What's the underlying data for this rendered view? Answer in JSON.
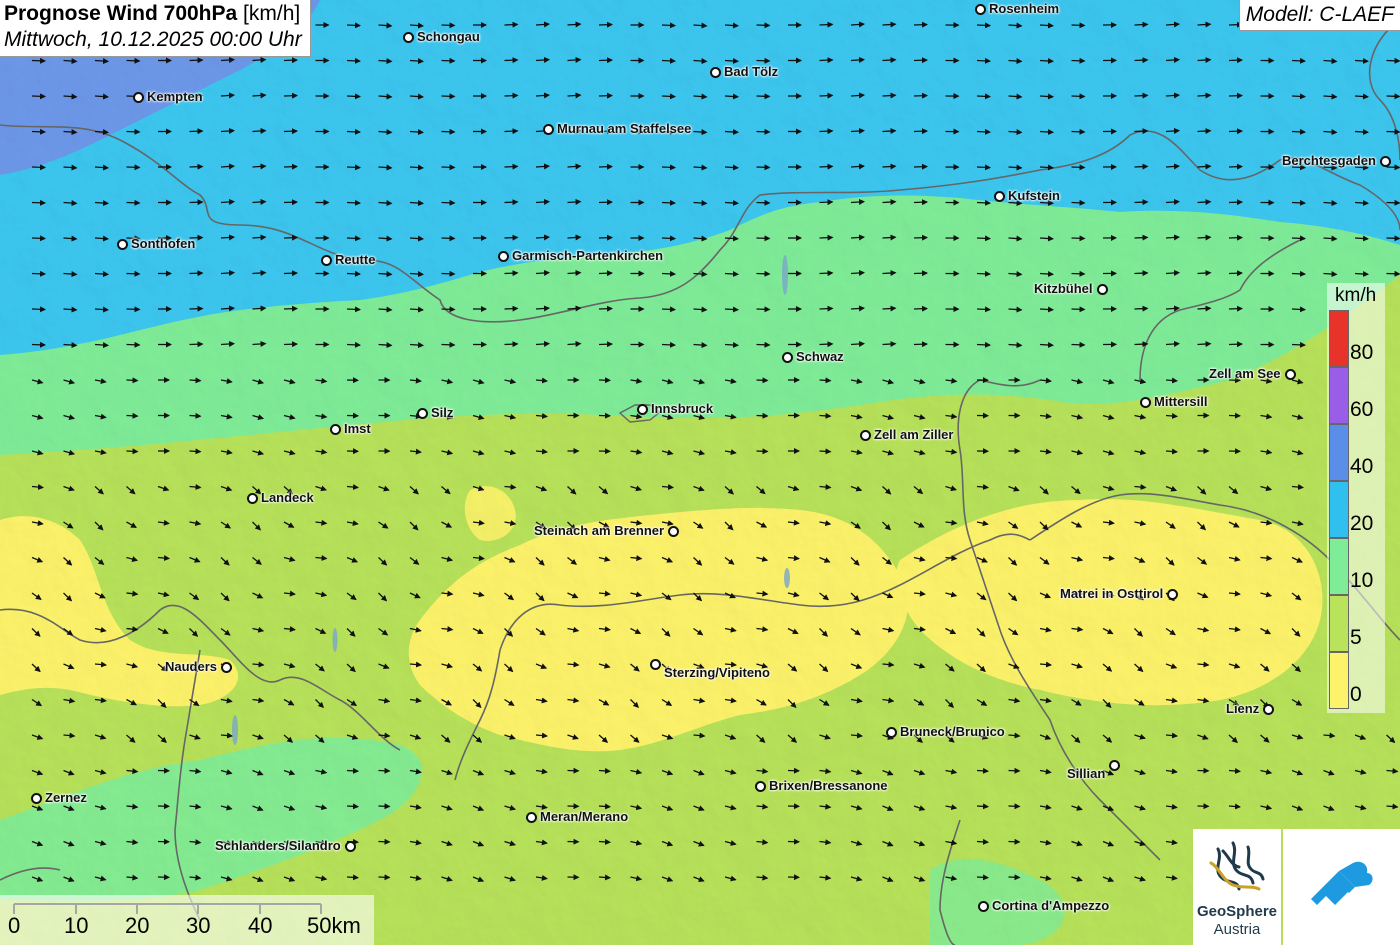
{
  "header": {
    "title_bold": "Prognose Wind 700hPa",
    "title_unit": "[km/h]",
    "datetime": "Mittwoch, 10.12.2025 00:00 Uhr",
    "model": "Modell: C-LAEF"
  },
  "legend": {
    "unit": "km/h",
    "items": [
      {
        "label": "80",
        "color": "#e8332b"
      },
      {
        "label": "60",
        "color": "#9a5de8"
      },
      {
        "label": "40",
        "color": "#5a8ee8"
      },
      {
        "label": "20",
        "color": "#2fc0ef"
      },
      {
        "label": "10",
        "color": "#7fed98"
      },
      {
        "label": "5",
        "color": "#b8e35a"
      },
      {
        "label": "0",
        "color": "#fdf36a"
      }
    ]
  },
  "scalebar": {
    "labels": [
      "0",
      "10",
      "20",
      "30",
      "40",
      "50km"
    ]
  },
  "cities": [
    {
      "name": "Rosenheim"
    },
    {
      "name": "Schongau"
    },
    {
      "name": "Bad Tölz"
    },
    {
      "name": "Kempten"
    },
    {
      "name": "Murnau am Staffelsee"
    },
    {
      "name": "Berchtesgaden"
    },
    {
      "name": "Kufstein"
    },
    {
      "name": "Sonthofen"
    },
    {
      "name": "Reutte"
    },
    {
      "name": "Garmisch-Partenkirchen"
    },
    {
      "name": "Kitzbühel"
    },
    {
      "name": "Schwaz"
    },
    {
      "name": "Zell am See"
    },
    {
      "name": "Mittersill"
    },
    {
      "name": "Silz"
    },
    {
      "name": "Innsbruck"
    },
    {
      "name": "Imst"
    },
    {
      "name": "Zell am Ziller"
    },
    {
      "name": "Landeck"
    },
    {
      "name": "Steinach am Brenner"
    },
    {
      "name": "Matrei in Osttirol"
    },
    {
      "name": "Nauders"
    },
    {
      "name": "Sterzing/Vipiteno"
    },
    {
      "name": "Lienz"
    },
    {
      "name": "Bruneck/Brunico"
    },
    {
      "name": "Sillian"
    },
    {
      "name": "Brixen/Bressanone"
    },
    {
      "name": "Zernez"
    },
    {
      "name": "Meran/Merano"
    },
    {
      "name": "Schlanders/Silandro"
    },
    {
      "name": "Cortina d'Ampezzo"
    }
  ],
  "logos": {
    "geosphere_name": "GeoSphere",
    "geosphere_sub": "Austria"
  }
}
